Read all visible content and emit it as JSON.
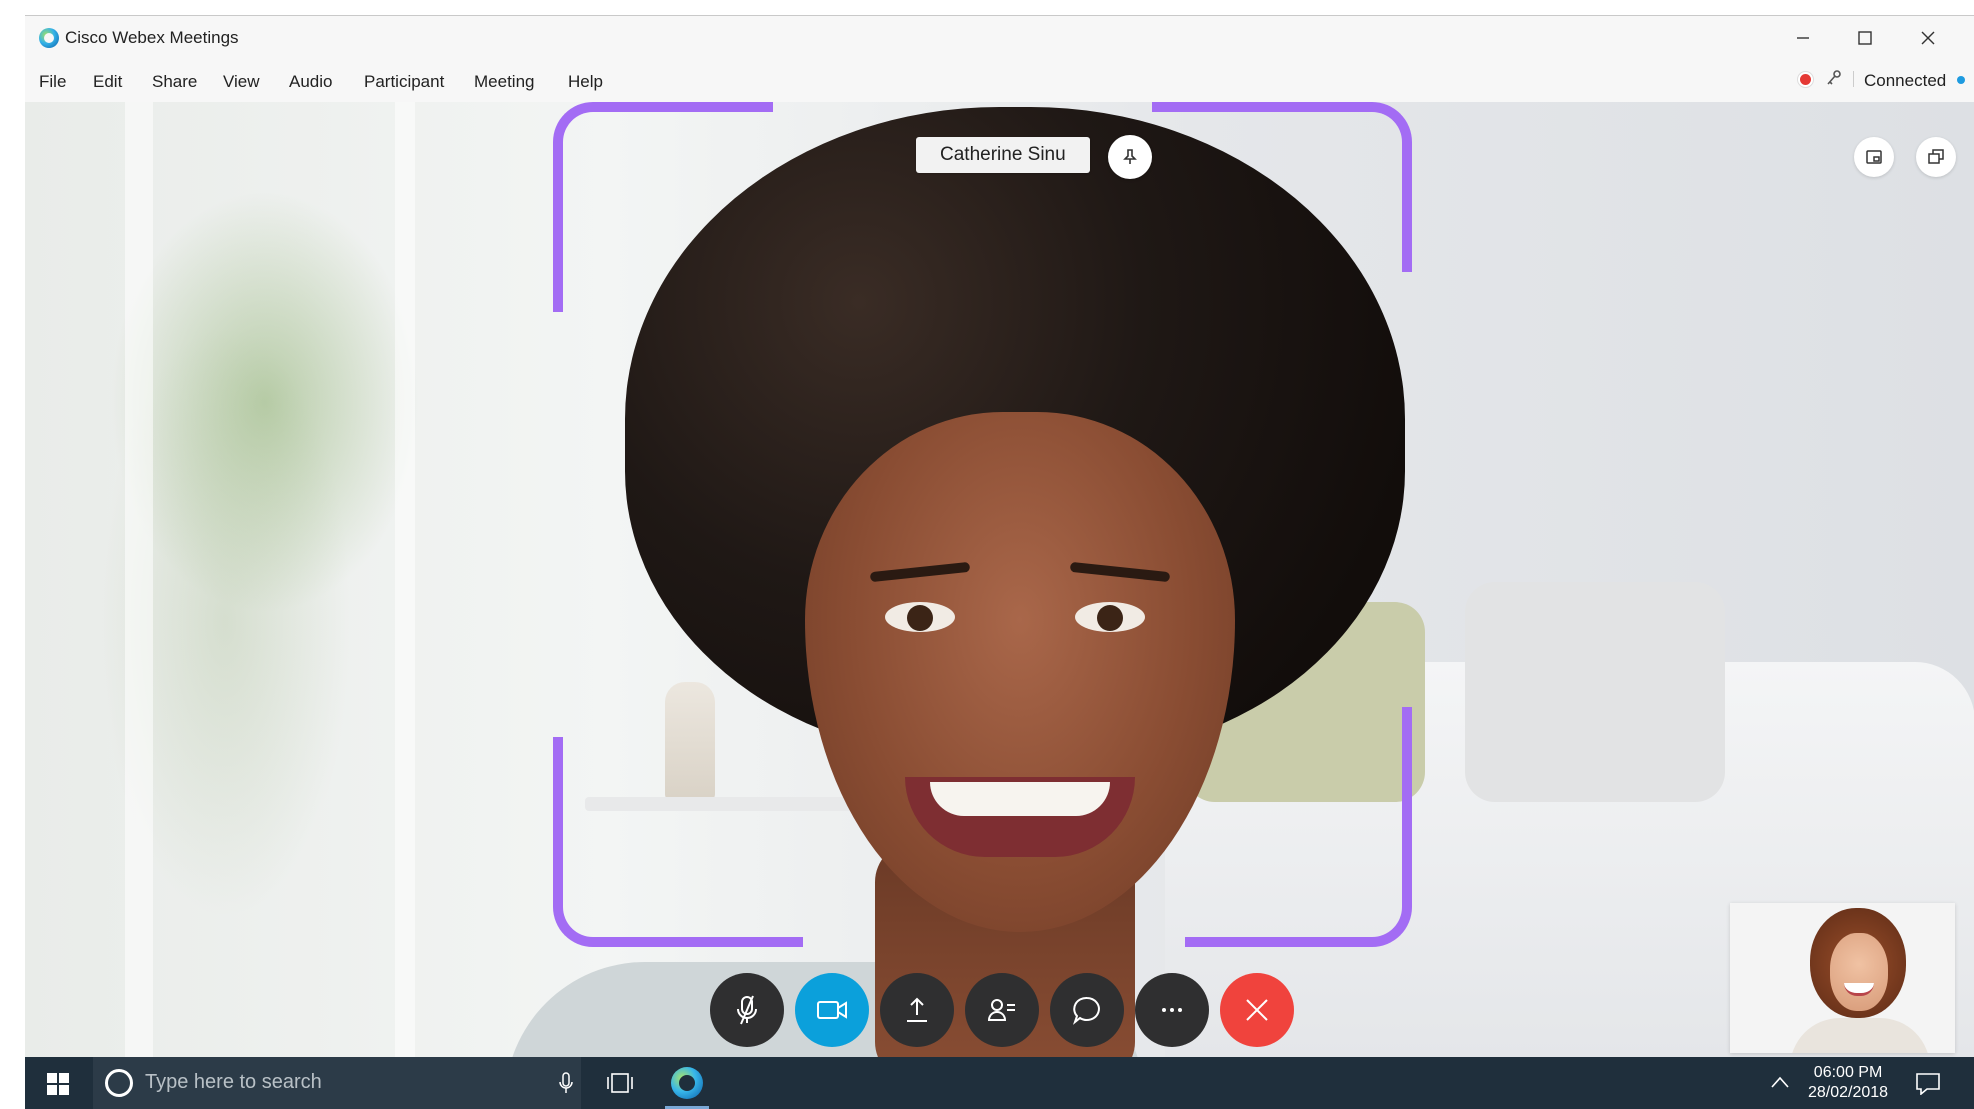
{
  "window": {
    "title": "Cisco Webex Meetings",
    "controls": {
      "minimize": "minimize",
      "maximize": "maximize",
      "close": "close"
    }
  },
  "menu": {
    "items": [
      {
        "label": "File"
      },
      {
        "label": "Edit"
      },
      {
        "label": "Share"
      },
      {
        "label": "View"
      },
      {
        "label": "Audio"
      },
      {
        "label": "Participant"
      },
      {
        "label": "Meeting"
      },
      {
        "label": "Help"
      }
    ]
  },
  "status": {
    "connection_label": "Connected",
    "recording_color": "#e53935",
    "connection_color": "#1e9be0"
  },
  "stage": {
    "active_speaker_name": "Catherine Sinu",
    "bracket_color": "#a36cf4"
  },
  "controls": {
    "video_color": "#0ba0db",
    "leave_color": "#f0433d",
    "buttons": [
      {
        "icon": "microphone-muted-icon"
      },
      {
        "icon": "video-camera-icon"
      },
      {
        "icon": "share-upload-icon"
      },
      {
        "icon": "participants-icon"
      },
      {
        "icon": "chat-bubble-icon"
      },
      {
        "icon": "more-options-icon"
      },
      {
        "icon": "leave-meeting-icon"
      }
    ]
  },
  "taskbar": {
    "search_placeholder": "Type here to search",
    "time": "06:00 PM",
    "date": "28/02/2018"
  }
}
